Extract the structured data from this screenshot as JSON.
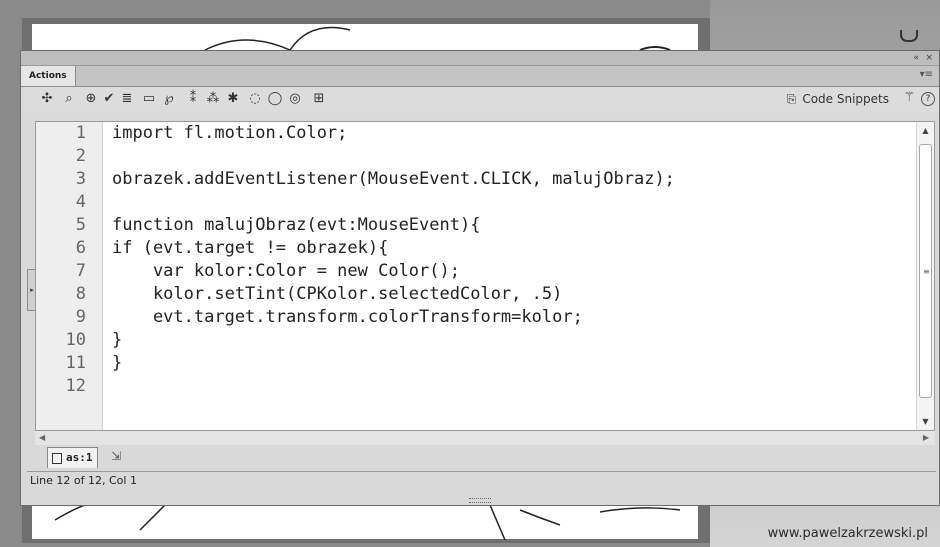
{
  "panel": {
    "tab_label": "Actions",
    "collapse_label": "«",
    "close_label": "×",
    "menu_label": "▾≡"
  },
  "toolbar": {
    "icons": [
      "add-statement-icon",
      "find-icon",
      "insert-target-icon",
      "check-syntax-icon",
      "auto-format-icon",
      "code-hint-icon",
      "debug-options-icon",
      "collapse-between-braces-icon",
      "collapse-selection-icon",
      "expand-all-icon",
      "apply-block-comment-icon",
      "apply-line-comment-icon",
      "remove-comment-icon",
      "show-hide-toolbox-icon"
    ],
    "snippets_label": "Code Snippets",
    "help_label": "?"
  },
  "editor": {
    "lines": [
      {
        "n": "1",
        "code": "import fl.motion.Color;"
      },
      {
        "n": "2",
        "code": ""
      },
      {
        "n": "3",
        "code": "obrazek.addEventListener(MouseEvent.CLICK, malujObraz);"
      },
      {
        "n": "4",
        "code": ""
      },
      {
        "n": "5",
        "code": "function malujObraz(evt:MouseEvent){"
      },
      {
        "n": "6",
        "code": "if (evt.target != obrazek){"
      },
      {
        "n": "7",
        "code": "    var kolor:Color = new Color();"
      },
      {
        "n": "8",
        "code": "    kolor.setTint(CPKolor.selectedColor, .5)"
      },
      {
        "n": "9",
        "code": "    evt.target.transform.colorTransform=kolor;"
      },
      {
        "n": "10",
        "code": "}"
      },
      {
        "n": "11",
        "code": "}"
      },
      {
        "n": "12",
        "code": ""
      }
    ]
  },
  "file_tab": {
    "label": "as:1"
  },
  "status": {
    "text": "Line 12 of 12, Col 1"
  },
  "watermark": "www.pawelzakrzewski.pl"
}
